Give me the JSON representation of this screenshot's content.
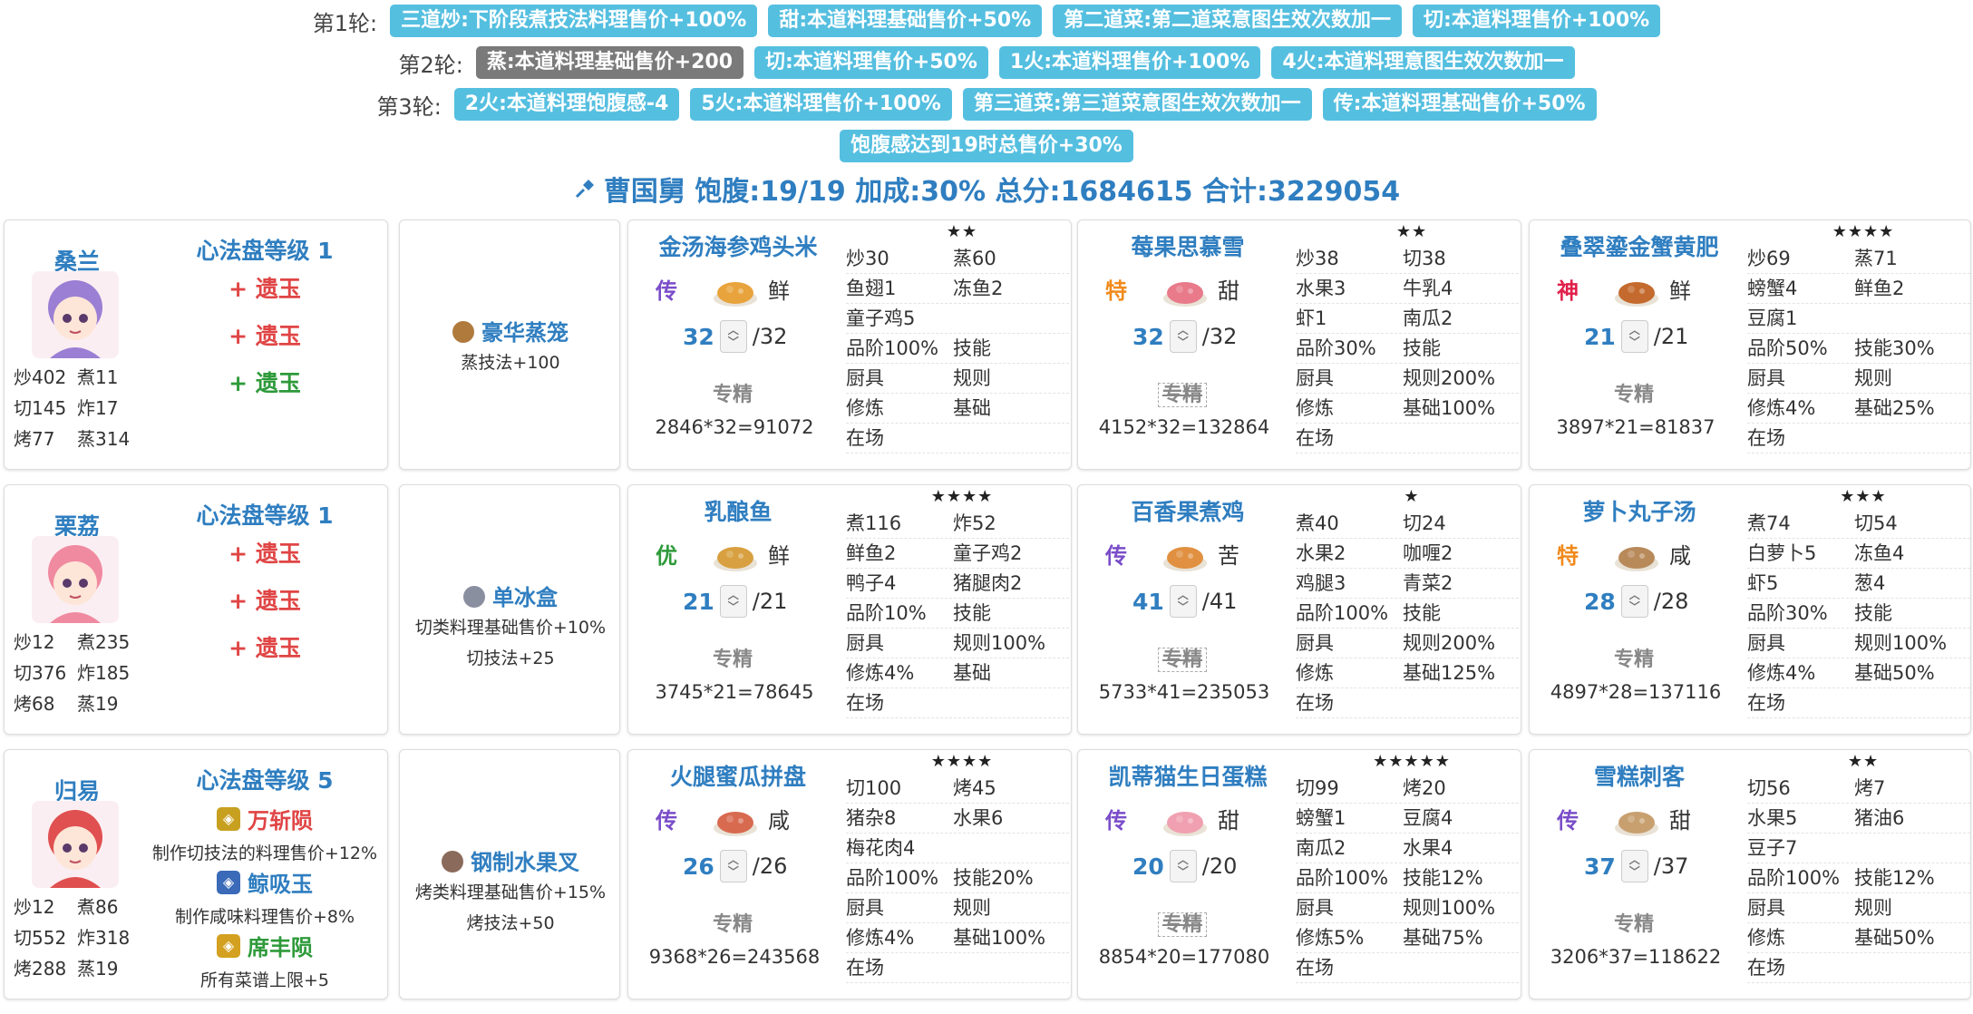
{
  "rounds": [
    {
      "label": "第1轮:",
      "tags": [
        {
          "text": "三道炒:下阶段煮技法料理售价+100%",
          "color": "#55bfe0"
        },
        {
          "text": "甜:本道料理基础售价+50%",
          "color": "#55bfe0"
        },
        {
          "text": "第二道菜:第二道菜意图生效次数加一",
          "color": "#55bfe0"
        },
        {
          "text": "切:本道料理售价+100%",
          "color": "#55bfe0"
        }
      ]
    },
    {
      "label": "第2轮:",
      "tags": [
        {
          "text": "蒸:本道料理基础售价+200",
          "color": "#7a7a7a"
        },
        {
          "text": "切:本道料理售价+50%",
          "color": "#55bfe0"
        },
        {
          "text": "1火:本道料理售价+100%",
          "color": "#55bfe0"
        },
        {
          "text": "4火:本道料理意图生效次数加一",
          "color": "#55bfe0"
        }
      ]
    },
    {
      "label": "第3轮:",
      "tags": [
        {
          "text": "2火:本道料理饱腹感-4",
          "color": "#55bfe0"
        },
        {
          "text": "5火:本道料理售价+100%",
          "color": "#55bfe0"
        },
        {
          "text": "第三道菜:第三道菜意图生效次数加一",
          "color": "#55bfe0"
        },
        {
          "text": "传:本道料理基础售价+50%",
          "color": "#55bfe0"
        }
      ]
    },
    {
      "label": "",
      "tags": [
        {
          "text": "饱腹感达到19时总售价+30%",
          "color": "#55bfe0"
        }
      ]
    }
  ],
  "summary": {
    "icon": "pin-icon",
    "text": "曹国舅 饱腹:19/19 加成:30% 总分:1684615 合计:3229054"
  },
  "rows": [
    {
      "chef": {
        "name": "桑兰",
        "avatar_color": "#9b7fd4",
        "stats": [
          "炒402",
          "煮11",
          "切145",
          "炸17",
          "烤77",
          "蒸314"
        ],
        "xf_title": "心法盘等级 1",
        "ambers": [
          {
            "type": "slot",
            "text": "+ 遗玉",
            "color": "red"
          },
          {
            "type": "slot",
            "text": "+ 遗玉",
            "color": "red"
          },
          {
            "type": "slot",
            "text": "+ 遗玉",
            "color": "green"
          }
        ]
      },
      "equip": {
        "name": "豪华蒸笼",
        "icon": "steamer-icon",
        "icon_color": "#b07a3c",
        "desc": [
          "蒸技法+100"
        ]
      },
      "dishes": [
        {
          "name": "金汤海参鸡头米",
          "stars": "★★",
          "rarity": "传",
          "rarity_color": "#7a4dc9",
          "flavor": "鲜",
          "qty": "32",
          "max": "/32",
          "spec": "专精",
          "spec_style": "plain",
          "calc": "2846*32=91072",
          "img_color": "#e8a33c",
          "ingredients": [
            [
              "炒30",
              "蒸60"
            ],
            [
              "鱼翅1",
              "冻鱼2"
            ],
            [
              "童子鸡5",
              ""
            ]
          ],
          "props": [
            [
              "品阶100%",
              "技能"
            ],
            [
              "厨具",
              "规则"
            ],
            [
              "修炼",
              "基础"
            ],
            [
              "在场",
              ""
            ]
          ]
        },
        {
          "name": "莓果思慕雪",
          "stars": "★★",
          "rarity": "特",
          "rarity_color": "#f08a1c",
          "flavor": "甜",
          "qty": "32",
          "max": "/32",
          "spec": "专精",
          "spec_style": "strike",
          "calc": "4152*32=132864",
          "img_color": "#e87a8a",
          "ingredients": [
            [
              "炒38",
              "切38"
            ],
            [
              "水果3",
              "牛乳4"
            ],
            [
              "虾1",
              "南瓜2"
            ]
          ],
          "props": [
            [
              "品阶30%",
              "技能"
            ],
            [
              "厨具",
              "规则200%"
            ],
            [
              "修炼",
              "基础100%"
            ],
            [
              "在场",
              ""
            ]
          ]
        },
        {
          "name": "叠翠鎏金蟹黄肥",
          "stars": "★★★★",
          "rarity": "神",
          "rarity_color": "#e0204a",
          "flavor": "鲜",
          "qty": "21",
          "max": "/21",
          "spec": "专精",
          "spec_style": "plain",
          "calc": "3897*21=81837",
          "img_color": "#c46a2e",
          "ingredients": [
            [
              "炒69",
              "蒸71"
            ],
            [
              "螃蟹4",
              "鲜鱼2"
            ],
            [
              "豆腐1",
              ""
            ]
          ],
          "props": [
            [
              "品阶50%",
              "技能30%"
            ],
            [
              "厨具",
              "规则"
            ],
            [
              "修炼4%",
              "基础25%"
            ],
            [
              "在场",
              ""
            ]
          ]
        }
      ]
    },
    {
      "chef": {
        "name": "栗荔",
        "avatar_color": "#f08aa0",
        "stats": [
          "炒12",
          "煮235",
          "切376",
          "炸185",
          "烤68",
          "蒸19"
        ],
        "xf_title": "心法盘等级 1",
        "ambers": [
          {
            "type": "slot",
            "text": "+ 遗玉",
            "color": "red"
          },
          {
            "type": "slot",
            "text": "+ 遗玉",
            "color": "red"
          },
          {
            "type": "slot",
            "text": "+ 遗玉",
            "color": "red"
          }
        ]
      },
      "equip": {
        "name": "单冰盒",
        "icon": "ice-box-icon",
        "icon_color": "#8a8fa0",
        "desc": [
          "切类料理基础售价+10%",
          "切技法+25"
        ]
      },
      "dishes": [
        {
          "name": "乳酿鱼",
          "stars": "★★★★",
          "rarity": "优",
          "rarity_color": "#2e9a3a",
          "flavor": "鲜",
          "qty": "21",
          "max": "/21",
          "spec": "专精",
          "spec_style": "plain",
          "calc": "3745*21=78645",
          "img_color": "#d8a040",
          "ingredients": [
            [
              "煮116",
              "炸52"
            ],
            [
              "鲜鱼2",
              "童子鸡2"
            ],
            [
              "鸭子4",
              "猪腿肉2"
            ]
          ],
          "props": [
            [
              "品阶10%",
              "技能"
            ],
            [
              "厨具",
              "规则100%"
            ],
            [
              "修炼4%",
              "基础"
            ],
            [
              "在场",
              ""
            ]
          ]
        },
        {
          "name": "百香果煮鸡",
          "stars": "★",
          "rarity": "传",
          "rarity_color": "#7a4dc9",
          "flavor": "苦",
          "qty": "41",
          "max": "/41",
          "spec": "专精",
          "spec_style": "strike",
          "calc": "5733*41=235053",
          "img_color": "#e09040",
          "ingredients": [
            [
              "煮40",
              "切24"
            ],
            [
              "水果2",
              "咖喱2"
            ],
            [
              "鸡腿3",
              "青菜2"
            ]
          ],
          "props": [
            [
              "品阶100%",
              "技能"
            ],
            [
              "厨具",
              "规则200%"
            ],
            [
              "修炼",
              "基础125%"
            ],
            [
              "在场",
              ""
            ]
          ]
        },
        {
          "name": "萝卜丸子汤",
          "stars": "★★★",
          "rarity": "特",
          "rarity_color": "#f08a1c",
          "flavor": "咸",
          "qty": "28",
          "max": "/28",
          "spec": "专精",
          "spec_style": "plain",
          "calc": "4897*28=137116",
          "img_color": "#b88a5a",
          "ingredients": [
            [
              "煮74",
              "切54"
            ],
            [
              "白萝卜5",
              "冻鱼4"
            ],
            [
              "虾5",
              "葱4"
            ]
          ],
          "props": [
            [
              "品阶30%",
              "技能"
            ],
            [
              "厨具",
              "规则100%"
            ],
            [
              "修炼4%",
              "基础50%"
            ],
            [
              "在场",
              ""
            ]
          ]
        }
      ]
    },
    {
      "chef": {
        "name": "归易",
        "avatar_color": "#e05050",
        "stats": [
          "炒12",
          "煮86",
          "切552",
          "炸318",
          "烤288",
          "蒸19"
        ],
        "xf_title": "心法盘等级 5",
        "ambers": [
          {
            "type": "amber",
            "name": "万斩陨",
            "color": "#e04545",
            "icon_bg": "#c8a020",
            "desc": "制作切技法的料理售价+12%"
          },
          {
            "type": "amber",
            "name": "鲸吸玉",
            "color": "#2f7ec0",
            "icon_bg": "#3a6ab8",
            "desc": "制作咸味料理售价+8%"
          },
          {
            "type": "amber",
            "name": "席丰陨",
            "color": "#2e9a3a",
            "icon_bg": "#d4a020",
            "desc": "所有菜谱上限+5"
          }
        ]
      },
      "equip": {
        "name": "钢制水果叉",
        "icon": "fork-icon",
        "icon_color": "#8a6a5a",
        "desc": [
          "烤类料理基础售价+15%",
          "烤技法+50"
        ]
      },
      "dishes": [
        {
          "name": "火腿蜜瓜拼盘",
          "stars": "★★★★",
          "rarity": "传",
          "rarity_color": "#7a4dc9",
          "flavor": "咸",
          "qty": "26",
          "max": "/26",
          "spec": "专精",
          "spec_style": "plain",
          "calc": "9368*26=243568",
          "img_color": "#d86a50",
          "ingredients": [
            [
              "切100",
              "烤45"
            ],
            [
              "猪杂8",
              "水果6"
            ],
            [
              "梅花肉4",
              ""
            ]
          ],
          "props": [
            [
              "品阶100%",
              "技能20%"
            ],
            [
              "厨具",
              "规则"
            ],
            [
              "修炼4%",
              "基础100%"
            ],
            [
              "在场",
              ""
            ]
          ]
        },
        {
          "name": "凯蒂猫生日蛋糕",
          "stars": "★★★★★",
          "rarity": "传",
          "rarity_color": "#7a4dc9",
          "flavor": "甜",
          "qty": "20",
          "max": "/20",
          "spec": "专精",
          "spec_style": "strike",
          "calc": "8854*20=177080",
          "img_color": "#f0a0b0",
          "ingredients": [
            [
              "切99",
              "烤20"
            ],
            [
              "螃蟹1",
              "豆腐4"
            ],
            [
              "南瓜2",
              "水果4"
            ]
          ],
          "props": [
            [
              "品阶100%",
              "技能12%"
            ],
            [
              "厨具",
              "规则100%"
            ],
            [
              "修炼5%",
              "基础75%"
            ],
            [
              "在场",
              ""
            ]
          ]
        },
        {
          "name": "雪糕刺客",
          "stars": "★★",
          "rarity": "传",
          "rarity_color": "#7a4dc9",
          "flavor": "甜",
          "qty": "37",
          "max": "/37",
          "spec": "专精",
          "spec_style": "plain",
          "calc": "3206*37=118622",
          "img_color": "#c8a070",
          "ingredients": [
            [
              "切56",
              "烤7"
            ],
            [
              "水果5",
              "猪油6"
            ],
            [
              "豆子7",
              ""
            ]
          ],
          "props": [
            [
              "品阶100%",
              "技能12%"
            ],
            [
              "厨具",
              "规则"
            ],
            [
              "修炼",
              "基础50%"
            ],
            [
              "在场",
              ""
            ]
          ]
        }
      ]
    }
  ]
}
